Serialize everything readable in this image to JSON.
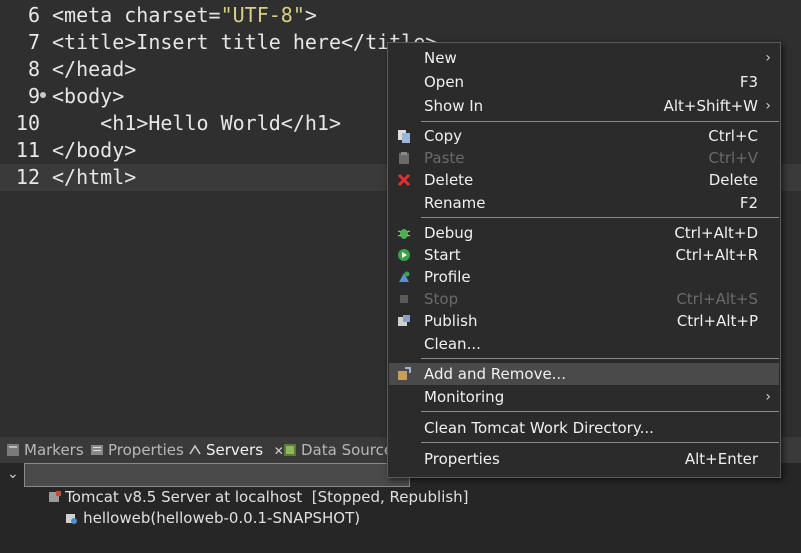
{
  "editor": {
    "lines": [
      {
        "num": "6",
        "pre": "<meta charset=",
        "str": "\"UTF-8\"",
        "post": ">"
      },
      {
        "num": "7",
        "pre": "<title>Insert title here</title>",
        "str": "",
        "post": ""
      },
      {
        "num": "8",
        "pre": "</head>",
        "str": "",
        "post": ""
      },
      {
        "num": "9",
        "pre": "<body>",
        "str": "",
        "post": ""
      },
      {
        "num": "10",
        "pre": "    <h1>Hello World</h1>",
        "str": "",
        "post": ""
      },
      {
        "num": "11",
        "pre": "</body>",
        "str": "",
        "post": ""
      },
      {
        "num": "12",
        "pre": "</html>",
        "str": "",
        "post": ""
      }
    ]
  },
  "bottom_panel": {
    "tabs": [
      {
        "label": "Markers",
        "icon": "markers-icon"
      },
      {
        "label": "Properties",
        "icon": "properties-icon"
      },
      {
        "label": "Servers",
        "icon": "servers-icon",
        "close": "✕"
      },
      {
        "label": "Data Source",
        "icon": "data-source-icon"
      }
    ],
    "server_row": "Tomcat v8.5 Server at localhost  [Stopped, Republish]",
    "module_row": "helloweb(helloweb-0.0.1-SNAPSHOT)",
    "expand_glyph": "⌄"
  },
  "context_menu": {
    "submenu_arrow": "›",
    "items": [
      {
        "label": "New",
        "accel": "",
        "submenu": true,
        "icon": ""
      },
      {
        "label": "Open",
        "accel": "F3",
        "submenu": false,
        "icon": ""
      },
      {
        "label": "Show In",
        "accel": "Alt+Shift+W",
        "submenu": true,
        "icon": ""
      },
      {
        "label": "Copy",
        "accel": "Ctrl+C",
        "submenu": false,
        "icon": "copy-icon"
      },
      {
        "label": "Paste",
        "accel": "Ctrl+V",
        "submenu": false,
        "icon": "paste-icon",
        "disabled": true
      },
      {
        "label": "Delete",
        "accel": "Delete",
        "submenu": false,
        "icon": "delete-icon"
      },
      {
        "label": "Rename",
        "accel": "F2",
        "submenu": false,
        "icon": ""
      },
      {
        "label": "Debug",
        "accel": "Ctrl+Alt+D",
        "submenu": false,
        "icon": "debug-icon"
      },
      {
        "label": "Start",
        "accel": "Ctrl+Alt+R",
        "submenu": false,
        "icon": "start-icon"
      },
      {
        "label": "Profile",
        "accel": "",
        "submenu": false,
        "icon": "profile-icon"
      },
      {
        "label": "Stop",
        "accel": "Ctrl+Alt+S",
        "submenu": false,
        "icon": "stop-icon",
        "disabled": true
      },
      {
        "label": "Publish",
        "accel": "Ctrl+Alt+P",
        "submenu": false,
        "icon": "publish-icon"
      },
      {
        "label": "Clean...",
        "accel": "",
        "submenu": false,
        "icon": ""
      },
      {
        "label": "Add and Remove...",
        "accel": "",
        "submenu": false,
        "icon": "add-remove-icon",
        "hover": true
      },
      {
        "label": "Monitoring",
        "accel": "",
        "submenu": true,
        "icon": ""
      },
      {
        "label": "Clean Tomcat Work Directory...",
        "accel": "",
        "submenu": false,
        "icon": ""
      },
      {
        "label": "Properties",
        "accel": "Alt+Enter",
        "submenu": false,
        "icon": ""
      }
    ]
  },
  "colors": {
    "editor_bg": "#2f2f2f",
    "string": "#d7d082",
    "menu_bg": "#2b2b2b",
    "menu_hover": "#4a4a4a",
    "delete_red": "#e03030"
  }
}
